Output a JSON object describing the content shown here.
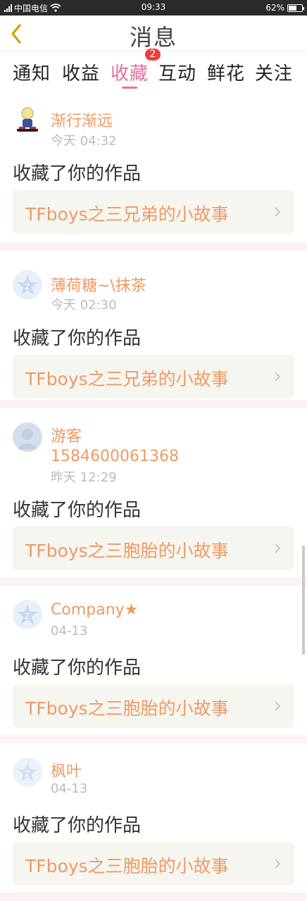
{
  "status_bar": {
    "carrier": "中国电信",
    "time": "09:33",
    "battery": "62%",
    "battery_level": 0.62
  },
  "header": {
    "title": "消息"
  },
  "tabs": [
    {
      "label": "通知"
    },
    {
      "label": "收益"
    },
    {
      "label": "收藏",
      "badge": "2",
      "active": true
    },
    {
      "label": "互动"
    },
    {
      "label": "鲜花"
    },
    {
      "label": "关注"
    }
  ],
  "notifications": [
    {
      "user": "渐行渐远",
      "time": "今天 04:32",
      "action": "收藏了你的作品",
      "work": "TFboys之三兄弟的小故事",
      "avatar": "cartoon-avatar"
    },
    {
      "user": "薄荷糖~\\抹茶",
      "time": "今天 02:30",
      "action": "收藏了你的作品",
      "work": "TFboys之三兄弟的小故事",
      "avatar": "default-star-avatar"
    },
    {
      "user": "游客",
      "user_line2": "1584600061368",
      "time": "昨天 12:29",
      "action": "收藏了你的作品",
      "work": "TFboys之三胞胎的小故事",
      "avatar": "guest-avatar"
    },
    {
      "user": "Company★",
      "time": "04-13",
      "action": "收藏了你的作品",
      "work": "TFboys之三胞胎的小故事",
      "avatar": "default-star-avatar"
    },
    {
      "user": "枫叶",
      "time": "04-13",
      "action": "收藏了你的作品",
      "work": "TFboys之三胞胎的小故事",
      "avatar": "default-star-avatar"
    }
  ],
  "colors": {
    "accent": "#e96ea0",
    "name": "#ef9a63",
    "badge": "#f23b3b",
    "separator": "#fdf1f3",
    "work_bg": "#f6f6f1"
  }
}
